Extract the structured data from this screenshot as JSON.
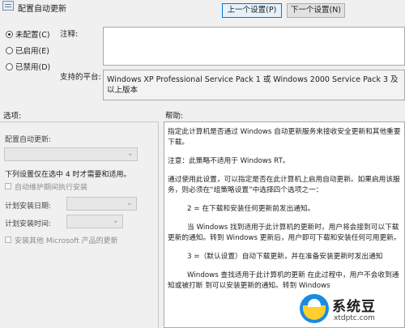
{
  "title": {
    "policy_name": "配置自动更新"
  },
  "nav": {
    "prev_label": "上一个设置(P)",
    "next_label": "下一个设置(N)"
  },
  "state_options": [
    {
      "label": "未配置(C)",
      "selected": true
    },
    {
      "label": "已启用(E)",
      "selected": false
    },
    {
      "label": "已禁用(D)",
      "selected": false
    }
  ],
  "comment": {
    "label": "注释:",
    "value": ""
  },
  "platform": {
    "label": "支持的平台:",
    "value": "Windows XP Professional Service Pack 1 或 Windows 2000 Service Pack 3 及以上版本"
  },
  "sections": {
    "options_label": "选项:",
    "help_label": "帮助:"
  },
  "options": {
    "configure_label": "配置自动更新:",
    "configure_value": "",
    "note": "下列设置仅在选中 4 时才需要和适用。",
    "maintenance_label": "自动维护期间执行安装",
    "install_day_label": "计划安装日期:",
    "install_day_value": "",
    "install_time_label": "计划安装时间:",
    "install_time_value": "",
    "other_products_label": "安装其他 Microsoft 产品的更新"
  },
  "help": {
    "p1": "指定此计算机是否通过 Windows 自动更新服务来接收安全更新和其他重要下载。",
    "p2": "注意：此策略不适用于 Windows RT。",
    "p3": "通过使用此设置，可以指定是否在此计算机上启用自动更新。如果启用该服务，则必须在“组策略设置”中选择四个选项之一：",
    "p4": "2 = 在下载和安装任何更新前发出通知。",
    "p5": "当 Windows 找到适用于此计算机的更新时，用户将会接到可以下载更新的通知。转到 Windows 更新后，用户即可下载和安装任何可用更新。",
    "p6": "3 =（默认设置）自动下载更新，并在准备安装更新时发出通知",
    "p7": "Windows 查找适用于此计算机的更新 在此过程中，用户不会收到通知或被打断 到可以安装更新的通知。转到 Windows"
  },
  "watermark": {
    "title": "系统豆",
    "sub": "xtdptc.com"
  }
}
